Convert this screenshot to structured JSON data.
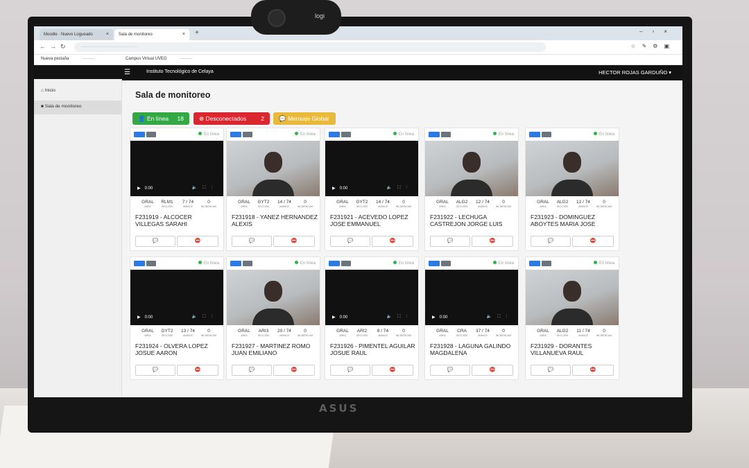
{
  "browser": {
    "tab1_label": "Moodle · Nuevo Logueado",
    "tab2_label": "Sala de monitoreo",
    "tab_close": "×",
    "new_tab": "+",
    "url": "·········································"
  },
  "bookmarks": [
    {
      "label": "Nueva pestaña"
    },
    {
      "label": "·········"
    },
    {
      "label": "Campus Virtual UVEG"
    },
    {
      "label": "·········"
    }
  ],
  "app": {
    "title": "Instituto Tecnológico de Celaya",
    "user": "HECTOR ROJAS GARDUÑO ▾",
    "menu_icon": "☰"
  },
  "sidebar": {
    "items": [
      {
        "label": "Inicio",
        "icon": "home-icon"
      },
      {
        "label": "Sala de monitoreo",
        "icon": "video-icon"
      }
    ]
  },
  "page": {
    "title": "Sala de monitoreo",
    "online": {
      "label": "En línea",
      "count": "18"
    },
    "offline": {
      "label": "Desconectados",
      "count": "2"
    },
    "broadcast": {
      "label": "Mensaje Global"
    }
  },
  "online_label": "En línea",
  "time_label": "0:00",
  "stat_labels": {
    "area": "AREA",
    "seccion": "SECCIÓN",
    "avance": "AVANCE",
    "incidencias": "INCIDENCIAS"
  },
  "students": [
    {
      "name": "F231919 - ALCOCER VILLEGAS SARAHI",
      "area": "GRAL",
      "seccion": "RLM1",
      "avance": "7 / 74",
      "incidencias": "0",
      "video": "blank"
    },
    {
      "name": "F231918 - YANEZ HERNANDEZ ALEXIS",
      "area": "GRAL",
      "seccion": "GYT2",
      "avance": "14 / 74",
      "incidencias": "0",
      "video": "camera"
    },
    {
      "name": "F231921 - ACEVEDO LOPEZ JOSE EMMANUEL",
      "area": "GRAL",
      "seccion": "GYT2",
      "avance": "14 / 74",
      "incidencias": "0",
      "video": "blank"
    },
    {
      "name": "F231922 - LECHUGA CASTREJON JORGE LUIS",
      "area": "GRAL",
      "seccion": "ALG2",
      "avance": "12 / 74",
      "incidencias": "0",
      "video": "camera"
    },
    {
      "name": "F231923 - DOMINGUEZ ABOYTES MARIA JOSE",
      "area": "GRAL",
      "seccion": "ALG2",
      "avance": "12 / 74",
      "incidencias": "0",
      "video": "camera"
    },
    {
      "name": "F231924 - OLVERA LOPEZ JOSUE AARON",
      "area": "GRAL",
      "seccion": "GYT2",
      "avance": "13 / 74",
      "incidencias": "0",
      "video": "blank"
    },
    {
      "name": "F231927 - MARTINEZ ROMO JUAN EMILIANO",
      "area": "GRAL",
      "seccion": "ARI3",
      "avance": "20 / 74",
      "incidencias": "0",
      "video": "camera"
    },
    {
      "name": "F231926 - PIMENTEL AGUILAR JOSUE RAUL",
      "area": "GRAL",
      "seccion": "ARI2",
      "avance": "8 / 74",
      "incidencias": "0",
      "video": "blank"
    },
    {
      "name": "F231928 - LAGUNA GALINDO MAGDALENA",
      "area": "GRAL",
      "seccion": "CRA",
      "avance": "37 / 74",
      "incidencias": "0",
      "video": "blank"
    },
    {
      "name": "F231929 - DORANTES VILLANUEVA RAUL",
      "area": "GRAL",
      "seccion": "ALG2",
      "avance": "11 / 74",
      "incidencias": "0",
      "video": "camera"
    }
  ],
  "monitor_brand": "ASUS",
  "webcam_brand": "logi"
}
